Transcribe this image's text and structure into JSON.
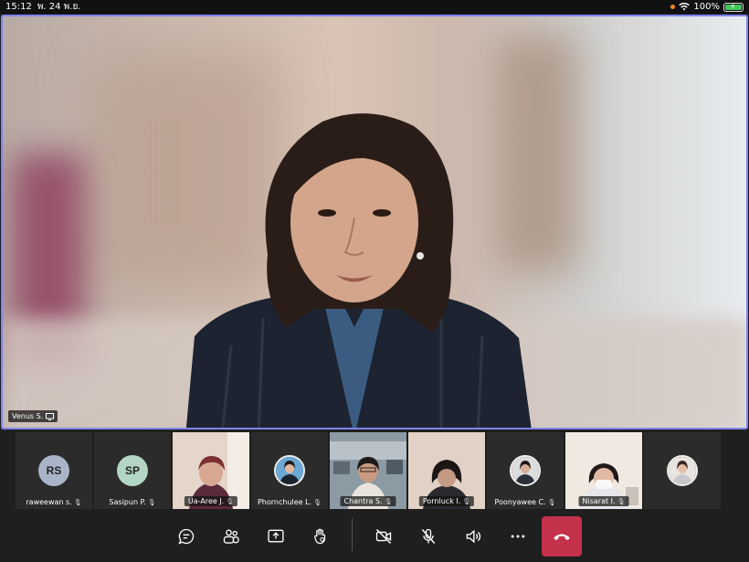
{
  "status_bar": {
    "time": "15:12",
    "date": "พ. 24 พ.ย.",
    "battery": "100%",
    "icons": [
      "location-dot-icon",
      "wifi-icon",
      "battery-charging-icon"
    ]
  },
  "main_video": {
    "speaker_name": "Venus S.",
    "icons": [
      "screen-share-icon"
    ]
  },
  "participants": [
    {
      "name": "raweewan s.",
      "initials": "RS",
      "type": "initials",
      "color": "#a9b4c8",
      "mic": "muted"
    },
    {
      "name": "Sasipun P.",
      "initials": "SP",
      "type": "initials",
      "color": "#b3d6c4",
      "mic": "muted"
    },
    {
      "name": "Ua-Aree J.",
      "type": "video",
      "mic": "muted"
    },
    {
      "name": "Phornchulee L.",
      "type": "avatar",
      "mic": "muted"
    },
    {
      "name": "Chantra S.",
      "type": "video",
      "mic": "muted"
    },
    {
      "name": "Pornluck I.",
      "type": "video",
      "mic": "muted"
    },
    {
      "name": "Poonyawee C.",
      "type": "avatar",
      "mic": "muted"
    },
    {
      "name": "Nisarat I.",
      "type": "video",
      "mic": "muted"
    },
    {
      "name": "",
      "type": "avatar",
      "mic": ""
    }
  ],
  "controls": {
    "buttons": [
      "chat-icon",
      "people-icon",
      "share-screen-icon",
      "raise-hand-icon",
      "camera-off-icon",
      "mic-off-icon",
      "speaker-icon",
      "more-icon",
      "hang-up-icon"
    ],
    "accent": "#7f85f5",
    "hangup_color": "#c4314b"
  }
}
